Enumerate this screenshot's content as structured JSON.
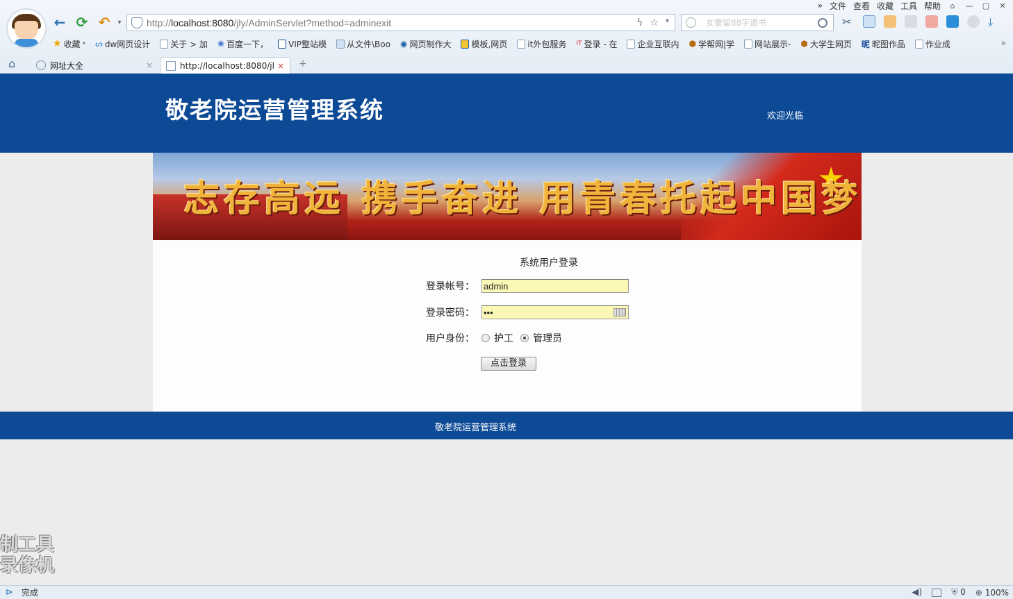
{
  "browser": {
    "menu": [
      "文件",
      "查看",
      "收藏",
      "工具",
      "帮助"
    ],
    "address": {
      "prefix": "http://",
      "host": "localhost:8080",
      "path": "/jly/AdminServlet?method=adminexit"
    },
    "search_placeholder": "女壹留88字遗书",
    "bookmarks": [
      "收藏",
      "dw网页设计",
      "关于 > 加",
      "百度一下，",
      "VIP整站模",
      "从文件\\Boo",
      "网页制作大",
      "模板,网页",
      "it外包服务",
      "登录 - 在",
      "企业互联内",
      "学帮网|学",
      "网站展示-",
      "大学生网页",
      "昵图作品",
      "作业成"
    ],
    "tabs": [
      {
        "label": "网址大全",
        "active": false
      },
      {
        "label": "http://localhost:8080/jl",
        "active": true
      }
    ],
    "status": {
      "left": "完成",
      "shield_count": "0",
      "zoom": "100%"
    }
  },
  "page": {
    "site_title": "敬老院运营管理系统",
    "welcome": "欢迎光临",
    "banner_slogan": "志存高远 携手奋进 用青春托起中国梦",
    "login": {
      "title": "系统用户登录",
      "account_label": "登录帐号：",
      "account_value": "admin",
      "password_label": "登录密码：",
      "password_value": "•••",
      "role_label": "用户身份：",
      "role_options": [
        "护工",
        "管理员"
      ],
      "role_selected": "管理员",
      "submit_label": "点击登录"
    },
    "footer": "敬老院运营管理系统"
  },
  "watermark": [
    "制工具",
    "录像机"
  ],
  "colors": {
    "header_blue": "#0d4a96",
    "field_yellow": "#fbf8b5"
  }
}
